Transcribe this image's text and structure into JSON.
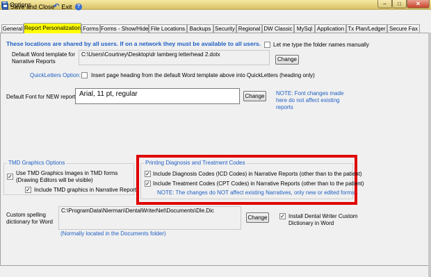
{
  "window": {
    "title": "Options",
    "app_icon_text": "W"
  },
  "toolbar": {
    "save_close": "Save and Close",
    "exit": "Exit"
  },
  "tabs": [
    "General",
    "Report Personalization",
    "Forms",
    "Forms - Show/Hide",
    "File Locations",
    "Backups",
    "Security",
    "Regional",
    "DW Classic",
    "MySql",
    "Application",
    "Tx Plan/Ledger",
    "Secure Fax"
  ],
  "active_tab": "Report Personalization",
  "shared_notice": "These locations are shared by all users.  If on a network they must be available to all users.",
  "let_me_type": {
    "label": "Let me type the folder names manually",
    "checked": false
  },
  "word_template": {
    "label": "Default Word template for Narrative Reports",
    "path": "C:\\Users\\Courtney\\Desktop\\dr lamberg letterhead 2.dotx",
    "change": "Change"
  },
  "quickletters": {
    "label": "QuickLetters Option:",
    "checkbox_label": "Insert page heading from the default Word template above into QuickLetters (heading only)",
    "checked": false
  },
  "default_font": {
    "label": "Default Font for NEW reports",
    "value": "Arial, 11 pt, regular",
    "change": "Change",
    "note": "NOTE: Font changes made here do not affect existing reports"
  },
  "tmd": {
    "title": "TMD Graphics Options",
    "use_images": "Use TMD Graphics Images in TMD forms (Drawing Editors will be visible)",
    "use_images_checked": true,
    "include_graphics": "Include TMD graphics in Narrative Reports",
    "include_graphics_checked": true
  },
  "codes": {
    "title": "Printing Diagnosis and Treatment Codes",
    "include_icd": "Include Diagnosis Codes (ICD Codes) in Narrative Reports (other than to the patient)",
    "include_icd_checked": true,
    "include_cpt": "Include Treatment Codes  (CPT Codes) in Narrative Reports (other than to the patient)",
    "include_cpt_checked": true,
    "note": "NOTE: The changes do NOT affect existing Narratives, only new or edited forms"
  },
  "spelling": {
    "label": "Custom spelling dictionary for Word",
    "path": "C:\\ProgramData\\Nierman\\DentalWriterNet\\Documents\\Dle.Dic",
    "change": "Change",
    "hint": "(Normally located in the Documents folder)",
    "install_label": "Install Dental Writer Custom Dictionary in Word",
    "install_checked": true
  },
  "colors": {
    "accent": "#1f5fc4",
    "highlight": "#ffff00",
    "red_box": "#e00000"
  }
}
